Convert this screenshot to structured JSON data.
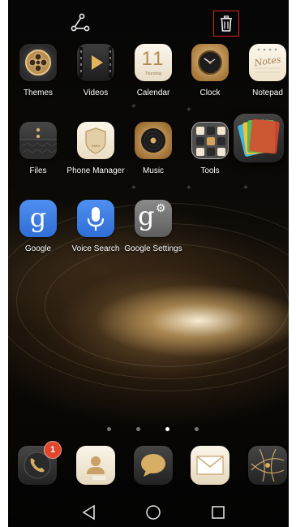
{
  "home_screen": {
    "toolbar": {
      "share_icon": "share-nodes-icon",
      "delete_icon": "trash-icon",
      "delete_highlight_color": "#d8232a"
    },
    "apps": [
      {
        "label": "Themes",
        "icon": "themes-icon"
      },
      {
        "label": "Videos",
        "icon": "videos-icon"
      },
      {
        "label": "Calendar",
        "icon": "calendar-icon",
        "date_number": "11",
        "day_text": "Thursday"
      },
      {
        "label": "Clock",
        "icon": "clock-icon"
      },
      {
        "label": "Notepad",
        "icon": "notepad-icon",
        "icon_text": "Notes"
      },
      {
        "label": "Files",
        "icon": "files-icon"
      },
      {
        "label": "Phone Manager",
        "icon": "phone-manager-icon",
        "icon_text": "EMUI"
      },
      {
        "label": "Music",
        "icon": "music-icon"
      },
      {
        "label": "Tools",
        "icon": "tools-folder-icon"
      },
      {
        "label": "",
        "icon": "dragged-app-icon"
      },
      {
        "label": "Google",
        "icon": "google-icon"
      },
      {
        "label": "Voice Search",
        "icon": "voice-search-icon"
      },
      {
        "label": "Google Settings",
        "icon": "google-settings-icon"
      }
    ],
    "page_indicator": {
      "pages": 4,
      "active_page": 3
    },
    "dock": [
      {
        "name": "Phone",
        "icon": "phone-icon",
        "badge": "1"
      },
      {
        "name": "Contacts",
        "icon": "contacts-icon"
      },
      {
        "name": "Messaging",
        "icon": "messaging-icon"
      },
      {
        "name": "Email",
        "icon": "email-icon"
      },
      {
        "name": "Browser",
        "icon": "browser-icon"
      }
    ],
    "navigation": {
      "back_icon": "back-triangle-icon",
      "home_icon": "home-circle-icon",
      "recents_icon": "recents-square-icon"
    }
  }
}
